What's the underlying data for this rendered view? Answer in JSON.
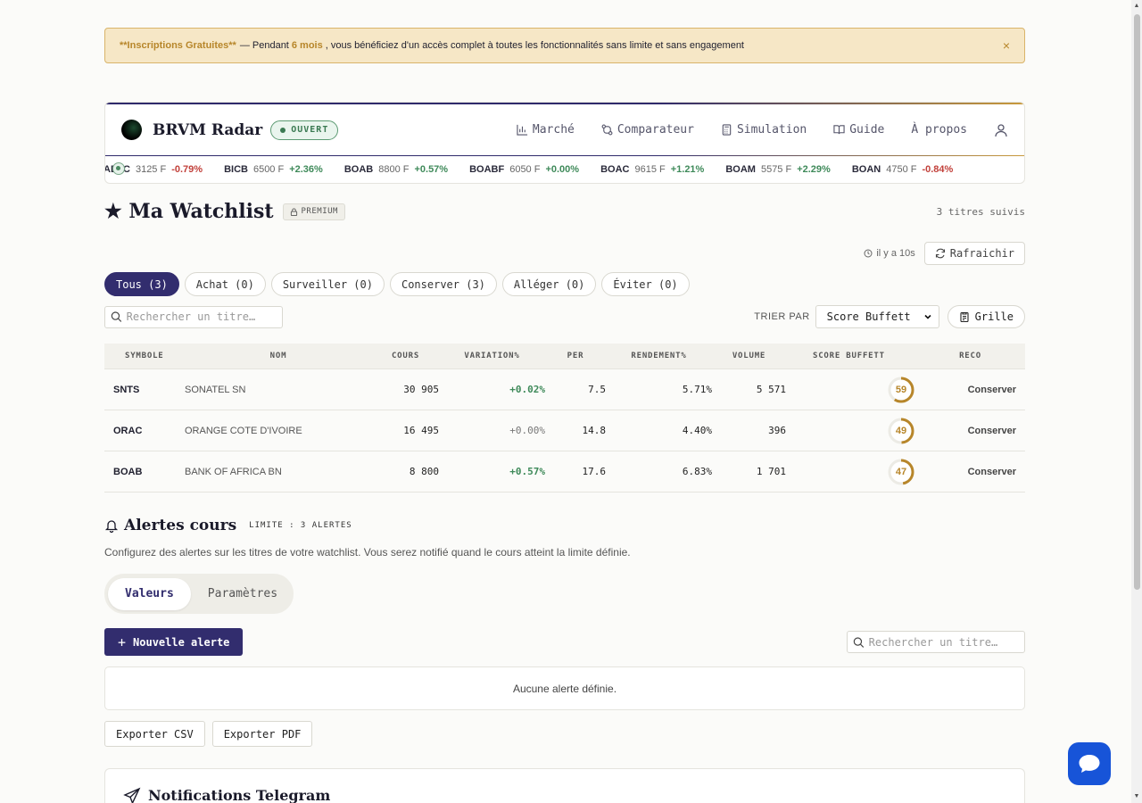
{
  "banner": {
    "bold_lead": "**Inscriptions Gratuites**",
    "text_a": "— Pendant",
    "highlight": "6 mois",
    "text_b": ", vous bénéficiez d'un accès complet à toutes les fonctionnalités sans limite et sans engagement",
    "close": "×"
  },
  "header": {
    "brand": "BRVM Radar",
    "status": "OUVERT",
    "nav": [
      {
        "label": "Marché",
        "icon": "bar-chart-icon"
      },
      {
        "label": "Comparateur",
        "icon": "compare-icon"
      },
      {
        "label": "Simulation",
        "icon": "calculator-icon"
      },
      {
        "label": "Guide",
        "icon": "book-icon"
      },
      {
        "label": "À propos",
        "icon": ""
      }
    ]
  },
  "ticker": [
    {
      "sym": "ABJC",
      "px": "3125 F",
      "chg": "-0.79%",
      "dir": "down"
    },
    {
      "sym": "BICB",
      "px": "6500 F",
      "chg": "+2.36%",
      "dir": "up"
    },
    {
      "sym": "BOAB",
      "px": "8800 F",
      "chg": "+0.57%",
      "dir": "up"
    },
    {
      "sym": "BOABF",
      "px": "6050 F",
      "chg": "+0.00%",
      "dir": "flat"
    },
    {
      "sym": "BOAC",
      "px": "9615 F",
      "chg": "+1.21%",
      "dir": "up"
    },
    {
      "sym": "BOAM",
      "px": "5575 F",
      "chg": "+2.29%",
      "dir": "up"
    },
    {
      "sym": "BOAN",
      "px": "4750 F",
      "chg": "-0.84%",
      "dir": "down"
    }
  ],
  "watchlist": {
    "title": "★ Ma Watchlist",
    "premium": "PREMIUM",
    "count": "3 titres suivis",
    "ago": "il y a 10s",
    "refresh": "Rafraichir",
    "filters": [
      "Tous (3)",
      "Achat (0)",
      "Surveiller (0)",
      "Conserver (3)",
      "Alléger (0)",
      "Éviter (0)"
    ],
    "search_placeholder": "Rechercher un titre…",
    "sort_label": "TRIER PAR",
    "sort_value": "Score Buffett",
    "view_toggle": "Grille",
    "columns": [
      "SYMBOLE",
      "NOM",
      "COURS",
      "VARIATION%",
      "PER",
      "RENDEMENT%",
      "VOLUME",
      "SCORE BUFFETT",
      "RECO"
    ],
    "rows": [
      {
        "sym": "SNTS",
        "name": "SONATEL SN",
        "cours": "30 905",
        "var": "+0.02%",
        "var_dir": "pos",
        "per": "7.5",
        "rend": "5.71%",
        "vol": "5 571",
        "score": "59",
        "score_value": 59,
        "reco": "Conserver"
      },
      {
        "sym": "ORAC",
        "name": "ORANGE COTE D'IVOIRE",
        "cours": "16 495",
        "var": "+0.00%",
        "var_dir": "neu",
        "per": "14.8",
        "rend": "4.40%",
        "vol": "396",
        "score": "49",
        "score_value": 49,
        "reco": "Conserver"
      },
      {
        "sym": "BOAB",
        "name": "BANK OF AFRICA BN",
        "cours": "8 800",
        "var": "+0.57%",
        "var_dir": "pos",
        "per": "17.6",
        "rend": "6.83%",
        "vol": "1 701",
        "score": "47",
        "score_value": 47,
        "reco": "Conserver"
      }
    ]
  },
  "alerts": {
    "title": "Alertes cours",
    "limit": "LIMITE : 3 ALERTES",
    "desc": "Configurez des alertes sur les titres de votre watchlist. Vous serez notifié quand le cours atteint la limite définie.",
    "tabs": [
      "Valeurs",
      "Paramètres"
    ],
    "new_button": "Nouvelle alerte",
    "search_placeholder": "Rechercher un titre…",
    "empty": "Aucune alerte définie.",
    "export_csv": "Exporter CSV",
    "export_pdf": "Exporter PDF"
  },
  "telegram": {
    "title": "Notifications Telegram"
  },
  "colors": {
    "primary": "#322d6e",
    "gold": "#b7862a",
    "up": "#3f8a5a",
    "down": "#c2413b",
    "chat": "#1754d8"
  }
}
